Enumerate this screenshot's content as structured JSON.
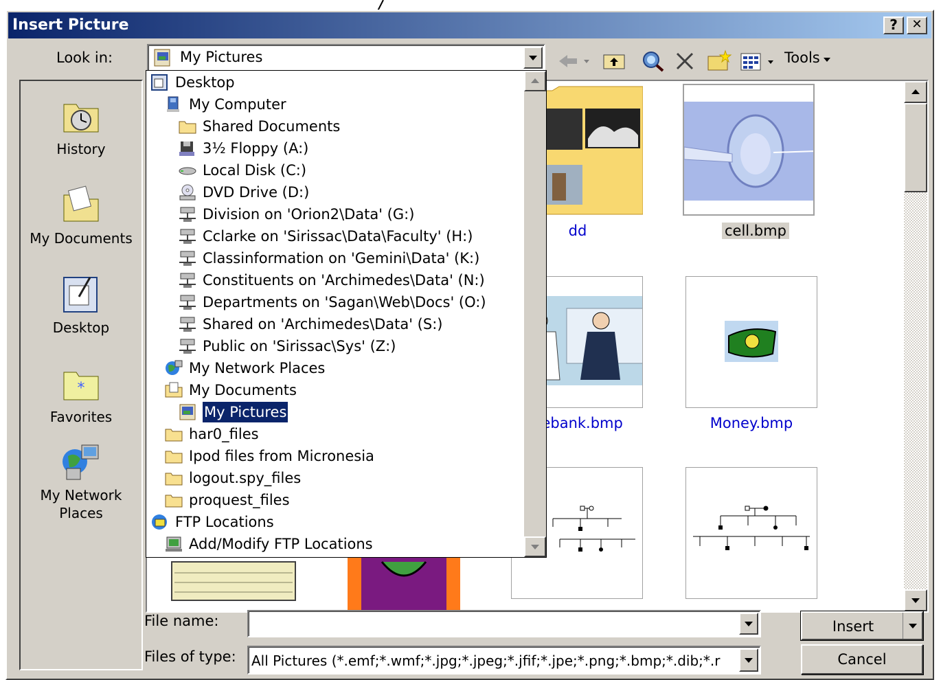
{
  "window": {
    "title": "Insert Picture",
    "help_label": "?",
    "close_label": "✕"
  },
  "toolbar": {
    "look_in_label": "Look in:",
    "look_in_value": "My Pictures",
    "tools_label": "Tools"
  },
  "places": [
    {
      "label": "History",
      "icon": "history-icon"
    },
    {
      "label": "My Documents",
      "icon": "my-documents-icon"
    },
    {
      "label": "Desktop",
      "icon": "desktop-icon"
    },
    {
      "label": "Favorites",
      "icon": "favorites-icon"
    },
    {
      "label": "My Network\nPlaces",
      "icon": "network-places-icon"
    }
  ],
  "dropdown": {
    "items": [
      {
        "label": "Desktop",
        "level": 0,
        "icon": "desktop-icon"
      },
      {
        "label": "My Computer",
        "level": 1,
        "icon": "computer-icon"
      },
      {
        "label": "Shared Documents",
        "level": 2,
        "icon": "folder-icon"
      },
      {
        "label": "3½ Floppy (A:)",
        "level": 2,
        "icon": "floppy-icon"
      },
      {
        "label": "Local Disk (C:)",
        "level": 2,
        "icon": "disk-icon"
      },
      {
        "label": "DVD Drive (D:)",
        "level": 2,
        "icon": "dvd-icon"
      },
      {
        "label": "Division on 'Orion2\\Data' (G:)",
        "level": 2,
        "icon": "network-drive-icon"
      },
      {
        "label": "Cclarke on 'Sirissac\\Data\\Faculty' (H:)",
        "level": 2,
        "icon": "network-drive-icon"
      },
      {
        "label": "Classinformation on 'Gemini\\Data' (K:)",
        "level": 2,
        "icon": "network-drive-icon"
      },
      {
        "label": "Constituents on 'Archimedes\\Data' (N:)",
        "level": 2,
        "icon": "network-drive-icon"
      },
      {
        "label": "Departments on 'Sagan\\Web\\Docs' (O:)",
        "level": 2,
        "icon": "network-drive-icon"
      },
      {
        "label": "Shared on 'Archimedes\\Data' (S:)",
        "level": 2,
        "icon": "network-drive-icon"
      },
      {
        "label": "Public on 'Sirissac\\Sys' (Z:)",
        "level": 2,
        "icon": "network-drive-icon"
      },
      {
        "label": "My Network Places",
        "level": 1,
        "icon": "network-places-icon"
      },
      {
        "label": "My Documents",
        "level": 1,
        "icon": "my-documents-icon"
      },
      {
        "label": "My Pictures",
        "level": 2,
        "icon": "my-pictures-icon",
        "selected": true
      },
      {
        "label": "har0_files",
        "level": 1,
        "icon": "folder-icon"
      },
      {
        "label": "Ipod files from Micronesia",
        "level": 1,
        "icon": "folder-icon"
      },
      {
        "label": "logout.spy_files",
        "level": 1,
        "icon": "folder-icon"
      },
      {
        "label": "proquest_files",
        "level": 1,
        "icon": "folder-icon"
      },
      {
        "label": "FTP Locations",
        "level": 0,
        "icon": "ftp-icon"
      },
      {
        "label": "Add/Modify FTP Locations",
        "level": 1,
        "icon": "ftp-add-icon"
      }
    ]
  },
  "files": [
    {
      "label": "dd",
      "kind": "folder"
    },
    {
      "label": "cell.bmp",
      "kind": "image"
    },
    {
      "label": "nebank.bmp",
      "kind": "image"
    },
    {
      "label": "Money.bmp",
      "kind": "image"
    }
  ],
  "form": {
    "filename_label": "File name:",
    "filename_value": "",
    "filetype_label": "Files of type:",
    "filetype_value": "All Pictures (*.emf;*.wmf;*.jpg;*.jpeg;*.jfif;*.jpe;*.png;*.bmp;*.dib;*.r",
    "insert_label": "Insert",
    "cancel_label": "Cancel"
  }
}
